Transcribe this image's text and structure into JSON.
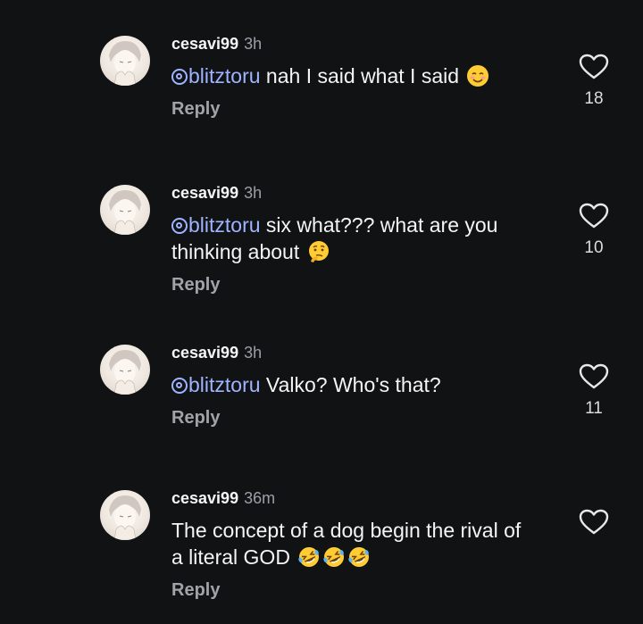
{
  "colors": {
    "background": "#101214",
    "mention": "#9fb3ff",
    "muted": "#9aa0a6",
    "text": "#f5f5f5"
  },
  "comments": [
    {
      "username": "cesavi99",
      "time": "3h",
      "mention": "blitztoru",
      "text": " nah I said what I said ",
      "emoji": [
        "smiling-face-emoji"
      ],
      "reply_label": "Reply",
      "likes": "18",
      "like_icon": "heart-outline-icon"
    },
    {
      "username": "cesavi99",
      "time": "3h",
      "mention": "blitztoru",
      "text": " six what??? what are you thinking about ",
      "emoji": [
        "thinking-face-emoji"
      ],
      "reply_label": "Reply",
      "likes": "10",
      "like_icon": "heart-outline-icon"
    },
    {
      "username": "cesavi99",
      "time": "3h",
      "mention": "blitztoru",
      "text": " Valko? Who's that?",
      "emoji": [],
      "reply_label": "Reply",
      "likes": "11",
      "like_icon": "heart-outline-icon"
    },
    {
      "username": "cesavi99",
      "time": "36m",
      "mention": "",
      "text": "The concept of a dog begin the rival of a literal GOD ",
      "emoji": [
        "rolling-laughing-emoji",
        "rolling-laughing-emoji",
        "rolling-laughing-emoji"
      ],
      "reply_label": "Reply",
      "likes": "",
      "like_icon": "heart-outline-icon"
    }
  ]
}
